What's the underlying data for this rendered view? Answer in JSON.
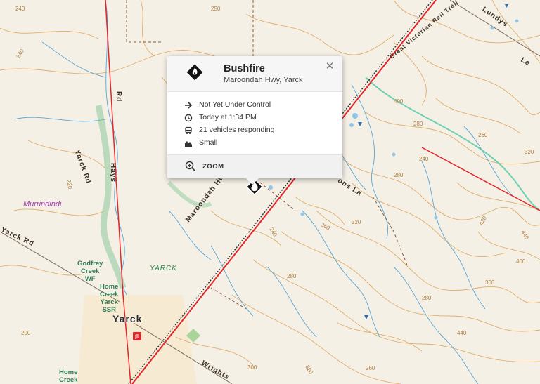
{
  "map": {
    "roads": [
      "Maroondah Hwy",
      "Yarck Rd",
      "Yarck Rd",
      "Hays",
      "Rd",
      "Wrights",
      "Great Victorian Rail Trail",
      "Lundys",
      "Le",
      "ons La"
    ],
    "places": {
      "region": "Murrindindi",
      "locality": "YARCK",
      "town": "Yarck",
      "fire_stations": [
        [
          "Godfrey",
          "Creek",
          "WF"
        ],
        [
          "Home",
          "Creek",
          "Yarck",
          "SSR"
        ],
        [
          "Home",
          "Creek"
        ]
      ]
    },
    "contour_labels": [
      "240",
      "220",
      "260",
      "240",
      "280",
      "240",
      "280",
      "300",
      "320",
      "320",
      "280",
      "420",
      "440",
      "400",
      "300",
      "320",
      "240",
      "260",
      "440",
      "400",
      "200",
      "260",
      "280",
      "250"
    ],
    "colors": {
      "highway": "#e5252a",
      "rail_trail": "#2c2c2c",
      "waterway": "#5aa5d6",
      "contour": "#e0ae6a",
      "vegetation_strip": "#8bc99a",
      "town_area": "#f5e6c8",
      "incident_marker": "#111111"
    }
  },
  "popup": {
    "icon": "bushfire-icon",
    "title": "Bushfire",
    "location": "Maroondah Hwy, Yarck",
    "close_icon": "close-icon",
    "details": [
      {
        "icon": "arrow-right-icon",
        "text": "Not Yet Under Control"
      },
      {
        "icon": "clock-icon",
        "text": "Today at 1:34 PM"
      },
      {
        "icon": "truck-icon",
        "text": "21 vehicles responding"
      },
      {
        "icon": "area-icon",
        "text": "Small"
      }
    ],
    "zoom_label": "ZOOM"
  }
}
